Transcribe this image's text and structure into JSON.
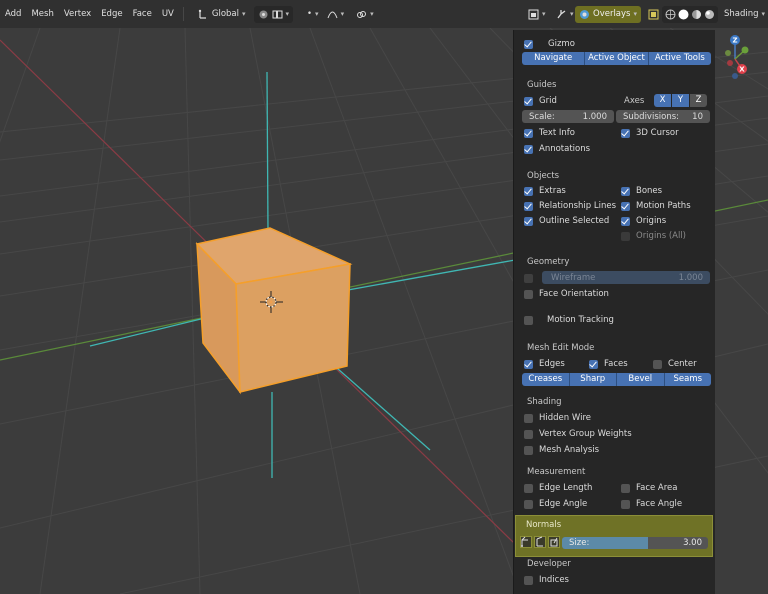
{
  "header": {
    "menu": [
      "Add",
      "Mesh",
      "Vertex",
      "Edge",
      "Face",
      "UV"
    ],
    "transform_orientation": "Global",
    "overlays_label": "Overlays",
    "shading_label": "Shading"
  },
  "gizmo_axes": {
    "z": "Z",
    "x": "X"
  },
  "panel": {
    "gizmo": {
      "label": "Gizmo",
      "buttons": [
        "Navigate",
        "Active Object",
        "Active Tools"
      ]
    },
    "guides": {
      "title": "Guides",
      "grid_label": "Grid",
      "axes_label": "Axes",
      "axes": [
        "X",
        "Y",
        "Z"
      ],
      "scale_label": "Scale:",
      "scale_value": "1.000",
      "subdiv_label": "Subdivisions:",
      "subdiv_value": "10",
      "text_info": "Text Info",
      "cursor_3d": "3D Cursor",
      "annotations": "Annotations"
    },
    "objects": {
      "title": "Objects",
      "extras": "Extras",
      "bones": "Bones",
      "relationship_lines": "Relationship Lines",
      "motion_paths": "Motion Paths",
      "outline_selected": "Outline Selected",
      "origins": "Origins",
      "origins_all": "Origins (All)"
    },
    "geometry": {
      "title": "Geometry",
      "wireframe_label": "Wireframe",
      "wireframe_value": "1.000",
      "face_orientation": "Face Orientation"
    },
    "motion_tracking": "Motion Tracking",
    "mesh_edit": {
      "title": "Mesh Edit Mode",
      "edges": "Edges",
      "faces": "Faces",
      "center": "Center",
      "buttons": [
        "Creases",
        "Sharp",
        "Bevel",
        "Seams"
      ]
    },
    "shading": {
      "title": "Shading",
      "hidden_wire": "Hidden Wire",
      "vertex_group_weights": "Vertex Group Weights",
      "mesh_analysis": "Mesh Analysis"
    },
    "measurement": {
      "title": "Measurement",
      "edge_length": "Edge Length",
      "face_area": "Face Area",
      "edge_angle": "Edge Angle",
      "face_angle": "Face Angle"
    },
    "normals": {
      "title": "Normals",
      "size_label": "Size:",
      "size_value": "3.00"
    },
    "developer": {
      "title": "Developer",
      "indices": "Indices"
    }
  }
}
